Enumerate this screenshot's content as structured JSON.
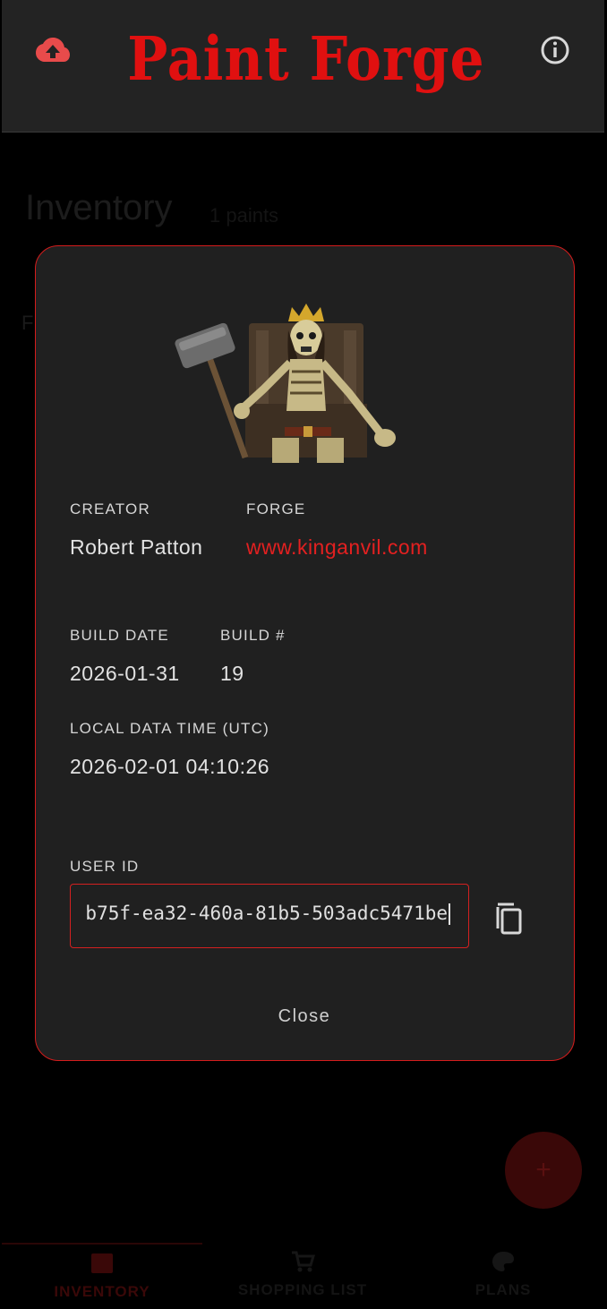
{
  "app": {
    "title": "Paint Forge"
  },
  "background_page": {
    "title": "Inventory",
    "subtitle": "1 paints",
    "letter": "F",
    "fab_icon": "+"
  },
  "bottom_nav": {
    "items": [
      {
        "label": "INVENTORY",
        "icon": "inventory-icon"
      },
      {
        "label": "SHOPPING LIST",
        "icon": "cart-icon"
      },
      {
        "label": "PLANS",
        "icon": "palette-icon"
      }
    ]
  },
  "dialog": {
    "creator_label": "CREATOR",
    "creator_value": "Robert Patton",
    "forge_label": "FORGE",
    "forge_value": "www.kinganvil.com",
    "build_date_label": "BUILD DATE",
    "build_date_value": "2026-01-31",
    "build_num_label": "BUILD #",
    "build_num_value": "19",
    "local_time_label": "LOCAL DATA TIME (UTC)",
    "local_time_value": "2026-02-01 04:10:26",
    "user_id_label": "USER ID",
    "user_id_value": "b75f-ea32-460a-81b5-503adc5471be",
    "close_label": "Close"
  },
  "colors": {
    "accent": "#e01010",
    "dialog_bg": "#202020",
    "appbar_bg": "#232323"
  }
}
